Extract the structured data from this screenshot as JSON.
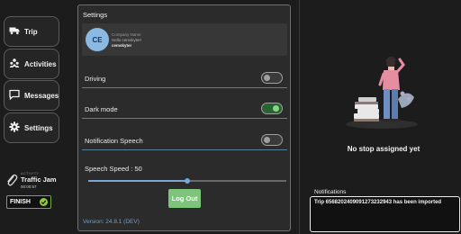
{
  "nav": {
    "items": [
      {
        "label": "Trip",
        "icon": "truck-icon"
      },
      {
        "label": "Activities",
        "icon": "people-icon"
      },
      {
        "label": "Messages",
        "icon": "chat-icon"
      },
      {
        "label": "Settings",
        "icon": "gear-icon"
      }
    ]
  },
  "activity": {
    "caption": "ACTIVITY",
    "name": "Traffic Jam",
    "time": "00:00:57",
    "icon": "paperclip-icon"
  },
  "finish": {
    "label": "FINISH",
    "icon": "check-icon",
    "accent": "#8dc63f"
  },
  "settings": {
    "title": "Settings",
    "profile": {
      "initials": "CE",
      "company": "Company Name",
      "greeting": "Hello cemskyter!",
      "username": "cemskyter"
    },
    "toggles": [
      {
        "label": "Driving",
        "on": false
      },
      {
        "label": "Dark mode",
        "on": true
      },
      {
        "label": "Notification Speech",
        "on": false
      }
    ],
    "speech_speed_label": "Speech Speed : 50",
    "speech_speed_value": 50,
    "logout_label": "Log Out",
    "version": "Version: 24.8.1 (DEV)"
  },
  "trip": {
    "empty_text": "No stop assigned yet"
  },
  "notifications": {
    "title": "Notifications",
    "items": [
      "Trip 6568202409091273232943 has been imported"
    ]
  }
}
